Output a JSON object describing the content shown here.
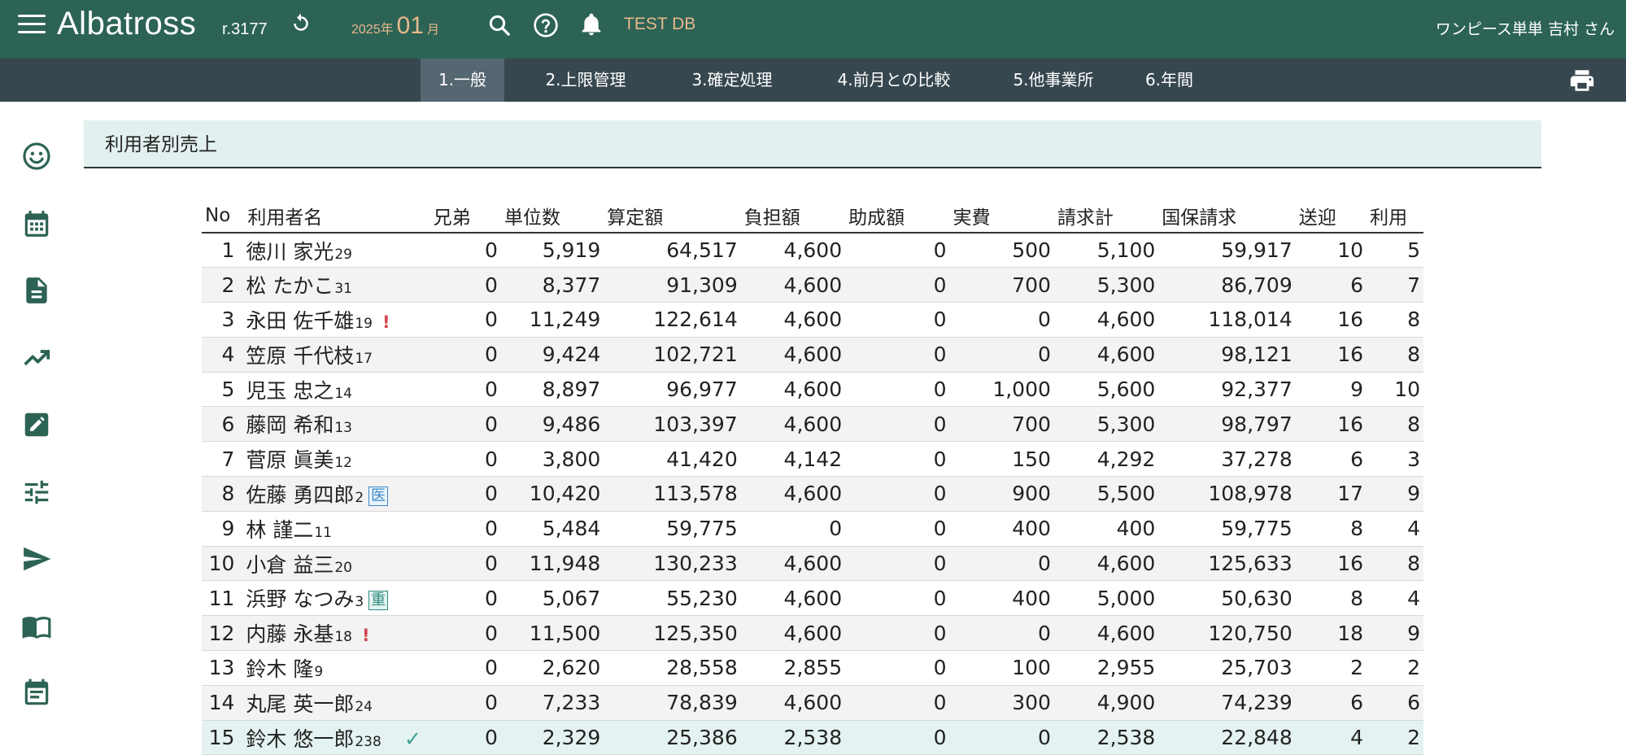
{
  "header": {
    "app_name": "Albatross",
    "revision": "r.3177",
    "period_year": "2025年",
    "period_month": "01",
    "period_unit": "月",
    "db_label": "TEST DB",
    "user_name": "ワンピース単単 吉村 さん"
  },
  "tabs": [
    {
      "label": "1.一般",
      "active": true
    },
    {
      "label": "2.上限管理"
    },
    {
      "label": "3.確定処理"
    },
    {
      "label": "4.前月との比較"
    },
    {
      "label": "5.他事業所"
    },
    {
      "label": "6.年間"
    }
  ],
  "sidebar_icons": [
    "smile-icon",
    "calendar-icon",
    "document-icon",
    "trending-up-icon",
    "edit-icon",
    "tune-icon",
    "send-icon",
    "book-icon",
    "event-note-icon"
  ],
  "section_title": "利用者別売上",
  "table": {
    "columns": [
      "No",
      "利用者名",
      "兄弟",
      "単位数",
      "算定額",
      "負担額",
      "助成額",
      "実費",
      "請求計",
      "国保請求",
      "送迎",
      "利用"
    ],
    "rows": [
      {
        "no": "1",
        "name": "徳川 家光",
        "age": "29",
        "sib": "0",
        "units": "5,919",
        "calc": "64,517",
        "burden": "4,600",
        "subsidy": "0",
        "actual": "500",
        "bill": "5,100",
        "kokuho": "59,917",
        "transport": "10",
        "use": "5"
      },
      {
        "no": "2",
        "name": "松 たかこ",
        "age": "31",
        "sib": "0",
        "units": "8,377",
        "calc": "91,309",
        "burden": "4,600",
        "subsidy": "0",
        "actual": "700",
        "bill": "5,300",
        "kokuho": "86,709",
        "transport": "6",
        "use": "7"
      },
      {
        "no": "3",
        "name": "永田 佐千雄",
        "age": "19",
        "flag": "!",
        "sib": "0",
        "units": "11,249",
        "calc": "122,614",
        "burden": "4,600",
        "subsidy": "0",
        "actual": "0",
        "bill": "4,600",
        "kokuho": "118,014",
        "transport": "16",
        "use": "8"
      },
      {
        "no": "4",
        "name": "笠原 千代枝",
        "age": "17",
        "sib": "0",
        "units": "9,424",
        "calc": "102,721",
        "burden": "4,600",
        "subsidy": "0",
        "actual": "0",
        "bill": "4,600",
        "kokuho": "98,121",
        "transport": "16",
        "use": "8"
      },
      {
        "no": "5",
        "name": "児玉 忠之",
        "age": "14",
        "sib": "0",
        "units": "8,897",
        "calc": "96,977",
        "burden": "4,600",
        "subsidy": "0",
        "actual": "1,000",
        "bill": "5,600",
        "kokuho": "92,377",
        "transport": "9",
        "use": "10"
      },
      {
        "no": "6",
        "name": "藤岡 希和",
        "age": "13",
        "sib": "0",
        "units": "9,486",
        "calc": "103,397",
        "burden": "4,600",
        "subsidy": "0",
        "actual": "700",
        "bill": "5,300",
        "kokuho": "98,797",
        "transport": "16",
        "use": "8"
      },
      {
        "no": "7",
        "name": "菅原 眞美",
        "age": "12",
        "sib": "0",
        "units": "3,800",
        "calc": "41,420",
        "burden": "4,142",
        "subsidy": "0",
        "actual": "150",
        "bill": "4,292",
        "kokuho": "37,278",
        "transport": "6",
        "use": "3"
      },
      {
        "no": "8",
        "name": "佐藤 勇四郎",
        "age": "2",
        "badge": "医",
        "badge_style": "blue",
        "sib": "0",
        "units": "10,420",
        "calc": "113,578",
        "burden": "4,600",
        "subsidy": "0",
        "actual": "900",
        "bill": "5,500",
        "kokuho": "108,978",
        "transport": "17",
        "use": "9"
      },
      {
        "no": "9",
        "name": "林 謹二",
        "age": "11",
        "sib": "0",
        "units": "5,484",
        "calc": "59,775",
        "burden": "0",
        "subsidy": "0",
        "actual": "400",
        "bill": "400",
        "kokuho": "59,775",
        "transport": "8",
        "use": "4"
      },
      {
        "no": "10",
        "name": "小倉 益三",
        "age": "20",
        "sib": "0",
        "units": "11,948",
        "calc": "130,233",
        "burden": "4,600",
        "subsidy": "0",
        "actual": "0",
        "bill": "4,600",
        "kokuho": "125,633",
        "transport": "16",
        "use": "8"
      },
      {
        "no": "11",
        "name": "浜野 なつみ",
        "age": "3",
        "badge": "重",
        "badge_style": "teal",
        "sib": "0",
        "units": "5,067",
        "calc": "55,230",
        "burden": "4,600",
        "subsidy": "0",
        "actual": "400",
        "bill": "5,000",
        "kokuho": "50,630",
        "transport": "8",
        "use": "4"
      },
      {
        "no": "12",
        "name": "内藤 永基",
        "age": "18",
        "flag": "!",
        "sib": "0",
        "units": "11,500",
        "calc": "125,350",
        "burden": "4,600",
        "subsidy": "0",
        "actual": "0",
        "bill": "4,600",
        "kokuho": "120,750",
        "transport": "18",
        "use": "9"
      },
      {
        "no": "13",
        "name": "鈴木 隆",
        "age": "9",
        "sib": "0",
        "units": "2,620",
        "calc": "28,558",
        "burden": "2,855",
        "subsidy": "0",
        "actual": "100",
        "bill": "2,955",
        "kokuho": "25,703",
        "transport": "2",
        "use": "2"
      },
      {
        "no": "14",
        "name": "丸尾 英一郎",
        "age": "24",
        "sib": "0",
        "units": "7,233",
        "calc": "78,839",
        "burden": "4,600",
        "subsidy": "0",
        "actual": "300",
        "bill": "4,900",
        "kokuho": "74,239",
        "transport": "6",
        "use": "6"
      },
      {
        "no": "15",
        "name": "鈴木 悠一郎",
        "age": "238",
        "check": "✓",
        "sib": "0",
        "units": "2,329",
        "calc": "25,386",
        "burden": "2,538",
        "subsidy": "0",
        "actual": "0",
        "bill": "2,538",
        "kokuho": "22,848",
        "transport": "4",
        "use": "2"
      }
    ]
  }
}
